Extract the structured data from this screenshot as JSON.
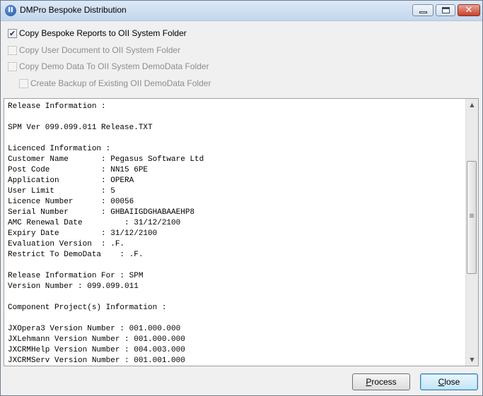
{
  "window": {
    "title": "DMPro Bespoke Distribution",
    "icon": "app-logo-icon",
    "controls": {
      "minimize": "minimize-icon",
      "maximize": "maximize-icon",
      "close": "close-icon"
    }
  },
  "options": [
    {
      "label": "Copy Bespoke Reports to OII System Folder",
      "checked": true,
      "enabled": true
    },
    {
      "label": "Copy User Document to OII System Folder",
      "checked": false,
      "enabled": false
    },
    {
      "label": "Copy Demo Data To OII System DemoData Folder",
      "checked": false,
      "enabled": false
    },
    {
      "label": "Create Backup of Existing OII DemoData Folder",
      "checked": false,
      "enabled": false
    }
  ],
  "info_text": [
    "Release Information :",
    "",
    "SPM Ver 099.099.011 Release.TXT",
    "",
    "Licenced Information :",
    "Customer Name       : Pegasus Software Ltd",
    "Post Code           : NN15 6PE",
    "Application         : OPERA",
    "User Limit          : 5",
    "Licence Number      : 00056",
    "Serial Number       : GHBAIIGDGHABAAEHP8",
    "AMC Renewal Date         : 31/12/2100",
    "Expiry Date         : 31/12/2100",
    "Evaluation Version  : .F.",
    "Restrict To DemoData    : .F.",
    "",
    "Release Information For : SPM",
    "Version Number : 099.099.011",
    "",
    "Component Project(s) Information :",
    "",
    "JXOpera3 Version Number : 001.000.000",
    "JXLehmann Version Number : 001.000.000",
    "JXCRMHelp Version Number : 004.003.000",
    "JXCRMServ Version Number : 001.001.000"
  ],
  "buttons": {
    "process": {
      "mnemonic": "P",
      "rest": "rocess"
    },
    "close": {
      "mnemonic": "C",
      "rest": "lose"
    }
  },
  "scrollbar": {
    "up_icon": "scroll-up-arrow-icon",
    "down_icon": "scroll-down-arrow-icon"
  }
}
